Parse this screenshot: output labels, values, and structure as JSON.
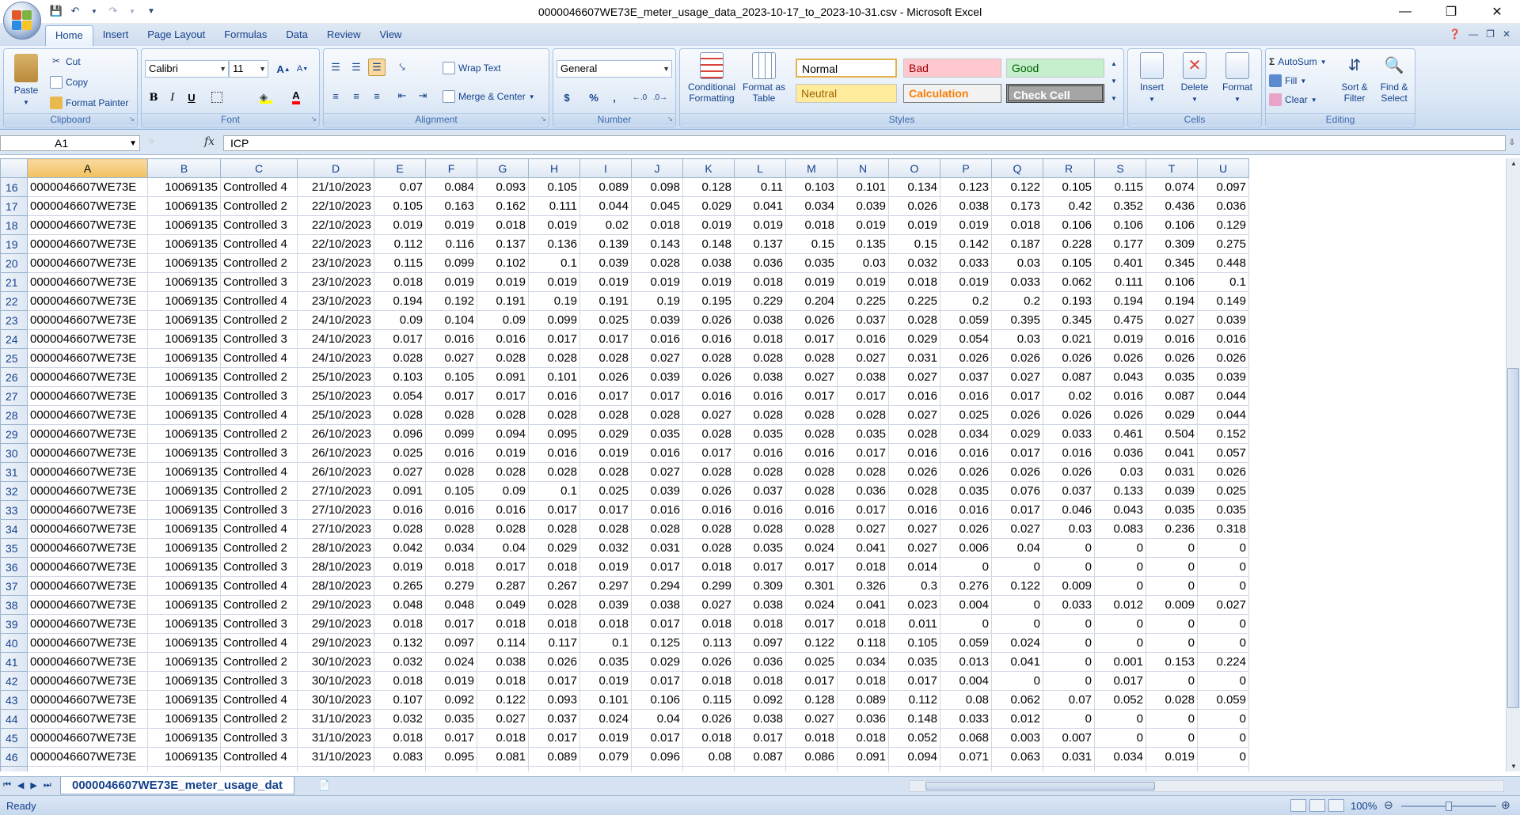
{
  "window": {
    "title": "0000046607WE73E_meter_usage_data_2023-10-17_to_2023-10-31.csv - Microsoft Excel"
  },
  "tabs": [
    "Home",
    "Insert",
    "Page Layout",
    "Formulas",
    "Data",
    "Review",
    "View"
  ],
  "clipboard": {
    "paste": "Paste",
    "cut": "Cut",
    "copy": "Copy",
    "format_painter": "Format Painter",
    "label": "Clipboard"
  },
  "font": {
    "name": "Calibri",
    "size": "11",
    "label": "Font",
    "bold": "B",
    "italic": "I",
    "underline": "U"
  },
  "alignment": {
    "wrap": "Wrap Text",
    "merge": "Merge & Center",
    "label": "Alignment"
  },
  "number": {
    "format": "General",
    "currency": "$",
    "percent": "%",
    "comma": ",",
    "label": "Number"
  },
  "styles": {
    "conditional": "Conditional Formatting",
    "format_table": "Format as Table",
    "normal": "Normal",
    "bad": "Bad",
    "good": "Good",
    "neutral": "Neutral",
    "calculation": "Calculation",
    "check": "Check Cell",
    "label": "Styles"
  },
  "cells": {
    "insert": "Insert",
    "delete": "Delete",
    "format": "Format",
    "label": "Cells"
  },
  "editing": {
    "autosum": "AutoSum",
    "fill": "Fill",
    "clear": "Clear",
    "sort": "Sort & Filter",
    "find": "Find & Select",
    "label": "Editing"
  },
  "formula_bar": {
    "name_box": "A1",
    "fx": "fx",
    "formula": "ICP"
  },
  "columns": [
    "A",
    "B",
    "C",
    "D",
    "E",
    "F",
    "G",
    "H",
    "I",
    "J",
    "K",
    "L",
    "M",
    "N",
    "O",
    "P",
    "Q",
    "R",
    "S",
    "T",
    "U"
  ],
  "rows": [
    {
      "n": "16",
      "c": [
        "0000046607WE73E",
        "10069135",
        "Controlled 4",
        "21/10/2023",
        "0.07",
        "0.084",
        "0.093",
        "0.105",
        "0.089",
        "0.098",
        "0.128",
        "0.11",
        "0.103",
        "0.101",
        "0.134",
        "0.123",
        "0.122",
        "0.105",
        "0.115",
        "0.074",
        "0.097"
      ]
    },
    {
      "n": "17",
      "c": [
        "0000046607WE73E",
        "10069135",
        "Controlled 2",
        "22/10/2023",
        "0.105",
        "0.163",
        "0.162",
        "0.111",
        "0.044",
        "0.045",
        "0.029",
        "0.041",
        "0.034",
        "0.039",
        "0.026",
        "0.038",
        "0.173",
        "0.42",
        "0.352",
        "0.436",
        "0.036"
      ]
    },
    {
      "n": "18",
      "c": [
        "0000046607WE73E",
        "10069135",
        "Controlled 3",
        "22/10/2023",
        "0.019",
        "0.019",
        "0.018",
        "0.019",
        "0.02",
        "0.018",
        "0.019",
        "0.019",
        "0.018",
        "0.019",
        "0.019",
        "0.019",
        "0.018",
        "0.106",
        "0.106",
        "0.106",
        "0.129"
      ]
    },
    {
      "n": "19",
      "c": [
        "0000046607WE73E",
        "10069135",
        "Controlled 4",
        "22/10/2023",
        "0.112",
        "0.116",
        "0.137",
        "0.136",
        "0.139",
        "0.143",
        "0.148",
        "0.137",
        "0.15",
        "0.135",
        "0.15",
        "0.142",
        "0.187",
        "0.228",
        "0.177",
        "0.309",
        "0.275"
      ]
    },
    {
      "n": "20",
      "c": [
        "0000046607WE73E",
        "10069135",
        "Controlled 2",
        "23/10/2023",
        "0.115",
        "0.099",
        "0.102",
        "0.1",
        "0.039",
        "0.028",
        "0.038",
        "0.036",
        "0.035",
        "0.03",
        "0.032",
        "0.033",
        "0.03",
        "0.105",
        "0.401",
        "0.345",
        "0.448"
      ]
    },
    {
      "n": "21",
      "c": [
        "0000046607WE73E",
        "10069135",
        "Controlled 3",
        "23/10/2023",
        "0.018",
        "0.019",
        "0.019",
        "0.019",
        "0.019",
        "0.019",
        "0.019",
        "0.018",
        "0.019",
        "0.019",
        "0.018",
        "0.019",
        "0.033",
        "0.062",
        "0.111",
        "0.106",
        "0.1"
      ]
    },
    {
      "n": "22",
      "c": [
        "0000046607WE73E",
        "10069135",
        "Controlled 4",
        "23/10/2023",
        "0.194",
        "0.192",
        "0.191",
        "0.19",
        "0.191",
        "0.19",
        "0.195",
        "0.229",
        "0.204",
        "0.225",
        "0.225",
        "0.2",
        "0.2",
        "0.193",
        "0.194",
        "0.194",
        "0.149"
      ]
    },
    {
      "n": "23",
      "c": [
        "0000046607WE73E",
        "10069135",
        "Controlled 2",
        "24/10/2023",
        "0.09",
        "0.104",
        "0.09",
        "0.099",
        "0.025",
        "0.039",
        "0.026",
        "0.038",
        "0.026",
        "0.037",
        "0.028",
        "0.059",
        "0.395",
        "0.345",
        "0.475",
        "0.027",
        "0.039"
      ]
    },
    {
      "n": "24",
      "c": [
        "0000046607WE73E",
        "10069135",
        "Controlled 3",
        "24/10/2023",
        "0.017",
        "0.016",
        "0.016",
        "0.017",
        "0.017",
        "0.016",
        "0.016",
        "0.018",
        "0.017",
        "0.016",
        "0.029",
        "0.054",
        "0.03",
        "0.021",
        "0.019",
        "0.016",
        "0.016"
      ]
    },
    {
      "n": "25",
      "c": [
        "0000046607WE73E",
        "10069135",
        "Controlled 4",
        "24/10/2023",
        "0.028",
        "0.027",
        "0.028",
        "0.028",
        "0.028",
        "0.027",
        "0.028",
        "0.028",
        "0.028",
        "0.027",
        "0.031",
        "0.026",
        "0.026",
        "0.026",
        "0.026",
        "0.026",
        "0.026"
      ]
    },
    {
      "n": "26",
      "c": [
        "0000046607WE73E",
        "10069135",
        "Controlled 2",
        "25/10/2023",
        "0.103",
        "0.105",
        "0.091",
        "0.101",
        "0.026",
        "0.039",
        "0.026",
        "0.038",
        "0.027",
        "0.038",
        "0.027",
        "0.037",
        "0.027",
        "0.087",
        "0.043",
        "0.035",
        "0.039"
      ]
    },
    {
      "n": "27",
      "c": [
        "0000046607WE73E",
        "10069135",
        "Controlled 3",
        "25/10/2023",
        "0.054",
        "0.017",
        "0.017",
        "0.016",
        "0.017",
        "0.017",
        "0.016",
        "0.016",
        "0.017",
        "0.017",
        "0.016",
        "0.016",
        "0.017",
        "0.02",
        "0.016",
        "0.087",
        "0.044"
      ]
    },
    {
      "n": "28",
      "c": [
        "0000046607WE73E",
        "10069135",
        "Controlled 4",
        "25/10/2023",
        "0.028",
        "0.028",
        "0.028",
        "0.028",
        "0.028",
        "0.028",
        "0.027",
        "0.028",
        "0.028",
        "0.028",
        "0.027",
        "0.025",
        "0.026",
        "0.026",
        "0.026",
        "0.029",
        "0.044"
      ]
    },
    {
      "n": "29",
      "c": [
        "0000046607WE73E",
        "10069135",
        "Controlled 2",
        "26/10/2023",
        "0.096",
        "0.099",
        "0.094",
        "0.095",
        "0.029",
        "0.035",
        "0.028",
        "0.035",
        "0.028",
        "0.035",
        "0.028",
        "0.034",
        "0.029",
        "0.033",
        "0.461",
        "0.504",
        "0.152"
      ]
    },
    {
      "n": "30",
      "c": [
        "0000046607WE73E",
        "10069135",
        "Controlled 3",
        "26/10/2023",
        "0.025",
        "0.016",
        "0.019",
        "0.016",
        "0.019",
        "0.016",
        "0.017",
        "0.016",
        "0.016",
        "0.017",
        "0.016",
        "0.016",
        "0.017",
        "0.016",
        "0.036",
        "0.041",
        "0.057"
      ]
    },
    {
      "n": "31",
      "c": [
        "0000046607WE73E",
        "10069135",
        "Controlled 4",
        "26/10/2023",
        "0.027",
        "0.028",
        "0.028",
        "0.028",
        "0.028",
        "0.027",
        "0.028",
        "0.028",
        "0.028",
        "0.028",
        "0.026",
        "0.026",
        "0.026",
        "0.026",
        "0.03",
        "0.031",
        "0.026"
      ]
    },
    {
      "n": "32",
      "c": [
        "0000046607WE73E",
        "10069135",
        "Controlled 2",
        "27/10/2023",
        "0.091",
        "0.105",
        "0.09",
        "0.1",
        "0.025",
        "0.039",
        "0.026",
        "0.037",
        "0.028",
        "0.036",
        "0.028",
        "0.035",
        "0.076",
        "0.037",
        "0.133",
        "0.039",
        "0.025"
      ]
    },
    {
      "n": "33",
      "c": [
        "0000046607WE73E",
        "10069135",
        "Controlled 3",
        "27/10/2023",
        "0.016",
        "0.016",
        "0.016",
        "0.017",
        "0.017",
        "0.016",
        "0.016",
        "0.016",
        "0.016",
        "0.017",
        "0.016",
        "0.016",
        "0.017",
        "0.046",
        "0.043",
        "0.035",
        "0.035"
      ]
    },
    {
      "n": "34",
      "c": [
        "0000046607WE73E",
        "10069135",
        "Controlled 4",
        "27/10/2023",
        "0.028",
        "0.028",
        "0.028",
        "0.028",
        "0.028",
        "0.028",
        "0.028",
        "0.028",
        "0.028",
        "0.027",
        "0.027",
        "0.026",
        "0.027",
        "0.03",
        "0.083",
        "0.236",
        "0.318"
      ]
    },
    {
      "n": "35",
      "c": [
        "0000046607WE73E",
        "10069135",
        "Controlled 2",
        "28/10/2023",
        "0.042",
        "0.034",
        "0.04",
        "0.029",
        "0.032",
        "0.031",
        "0.028",
        "0.035",
        "0.024",
        "0.041",
        "0.027",
        "0.006",
        "0.04",
        "0",
        "0",
        "0",
        "0"
      ]
    },
    {
      "n": "36",
      "c": [
        "0000046607WE73E",
        "10069135",
        "Controlled 3",
        "28/10/2023",
        "0.019",
        "0.018",
        "0.017",
        "0.018",
        "0.019",
        "0.017",
        "0.018",
        "0.017",
        "0.017",
        "0.018",
        "0.014",
        "0",
        "0",
        "0",
        "0",
        "0",
        "0"
      ]
    },
    {
      "n": "37",
      "c": [
        "0000046607WE73E",
        "10069135",
        "Controlled 4",
        "28/10/2023",
        "0.265",
        "0.279",
        "0.287",
        "0.267",
        "0.297",
        "0.294",
        "0.299",
        "0.309",
        "0.301",
        "0.326",
        "0.3",
        "0.276",
        "0.122",
        "0.009",
        "0",
        "0",
        "0"
      ]
    },
    {
      "n": "38",
      "c": [
        "0000046607WE73E",
        "10069135",
        "Controlled 2",
        "29/10/2023",
        "0.048",
        "0.048",
        "0.049",
        "0.028",
        "0.039",
        "0.038",
        "0.027",
        "0.038",
        "0.024",
        "0.041",
        "0.023",
        "0.004",
        "0",
        "0.033",
        "0.012",
        "0.009",
        "0.027"
      ]
    },
    {
      "n": "39",
      "c": [
        "0000046607WE73E",
        "10069135",
        "Controlled 3",
        "29/10/2023",
        "0.018",
        "0.017",
        "0.018",
        "0.018",
        "0.018",
        "0.017",
        "0.018",
        "0.018",
        "0.017",
        "0.018",
        "0.011",
        "0",
        "0",
        "0",
        "0",
        "0",
        "0"
      ]
    },
    {
      "n": "40",
      "c": [
        "0000046607WE73E",
        "10069135",
        "Controlled 4",
        "29/10/2023",
        "0.132",
        "0.097",
        "0.114",
        "0.117",
        "0.1",
        "0.125",
        "0.113",
        "0.097",
        "0.122",
        "0.118",
        "0.105",
        "0.059",
        "0.024",
        "0",
        "0",
        "0",
        "0"
      ]
    },
    {
      "n": "41",
      "c": [
        "0000046607WE73E",
        "10069135",
        "Controlled 2",
        "30/10/2023",
        "0.032",
        "0.024",
        "0.038",
        "0.026",
        "0.035",
        "0.029",
        "0.026",
        "0.036",
        "0.025",
        "0.034",
        "0.035",
        "0.013",
        "0.041",
        "0",
        "0.001",
        "0.153",
        "0.224"
      ]
    },
    {
      "n": "42",
      "c": [
        "0000046607WE73E",
        "10069135",
        "Controlled 3",
        "30/10/2023",
        "0.018",
        "0.019",
        "0.018",
        "0.017",
        "0.019",
        "0.017",
        "0.018",
        "0.018",
        "0.017",
        "0.018",
        "0.017",
        "0.004",
        "0",
        "0",
        "0.017",
        "0",
        "0"
      ]
    },
    {
      "n": "43",
      "c": [
        "0000046607WE73E",
        "10069135",
        "Controlled 4",
        "30/10/2023",
        "0.107",
        "0.092",
        "0.122",
        "0.093",
        "0.101",
        "0.106",
        "0.115",
        "0.092",
        "0.128",
        "0.089",
        "0.112",
        "0.08",
        "0.062",
        "0.07",
        "0.052",
        "0.028",
        "0.059"
      ]
    },
    {
      "n": "44",
      "c": [
        "0000046607WE73E",
        "10069135",
        "Controlled 2",
        "31/10/2023",
        "0.032",
        "0.035",
        "0.027",
        "0.037",
        "0.024",
        "0.04",
        "0.026",
        "0.038",
        "0.027",
        "0.036",
        "0.148",
        "0.033",
        "0.012",
        "0",
        "0",
        "0",
        "0"
      ]
    },
    {
      "n": "45",
      "c": [
        "0000046607WE73E",
        "10069135",
        "Controlled 3",
        "31/10/2023",
        "0.018",
        "0.017",
        "0.018",
        "0.017",
        "0.019",
        "0.017",
        "0.018",
        "0.017",
        "0.018",
        "0.018",
        "0.052",
        "0.068",
        "0.003",
        "0.007",
        "0",
        "0",
        "0"
      ]
    },
    {
      "n": "46",
      "c": [
        "0000046607WE73E",
        "10069135",
        "Controlled 4",
        "31/10/2023",
        "0.083",
        "0.095",
        "0.081",
        "0.089",
        "0.079",
        "0.096",
        "0.08",
        "0.087",
        "0.086",
        "0.091",
        "0.094",
        "0.071",
        "0.063",
        "0.031",
        "0.034",
        "0.019",
        "0"
      ]
    },
    {
      "n": "47",
      "c": [
        "",
        "",
        "",
        "",
        "",
        "",
        "",
        "",
        "",
        "",
        "",
        "",
        "",
        "",
        "",
        "",
        "",
        "",
        "",
        "",
        ""
      ]
    }
  ],
  "sheet_tab": "0000046607WE73E_meter_usage_dat",
  "status": {
    "text": "Ready",
    "zoom": "100%"
  }
}
